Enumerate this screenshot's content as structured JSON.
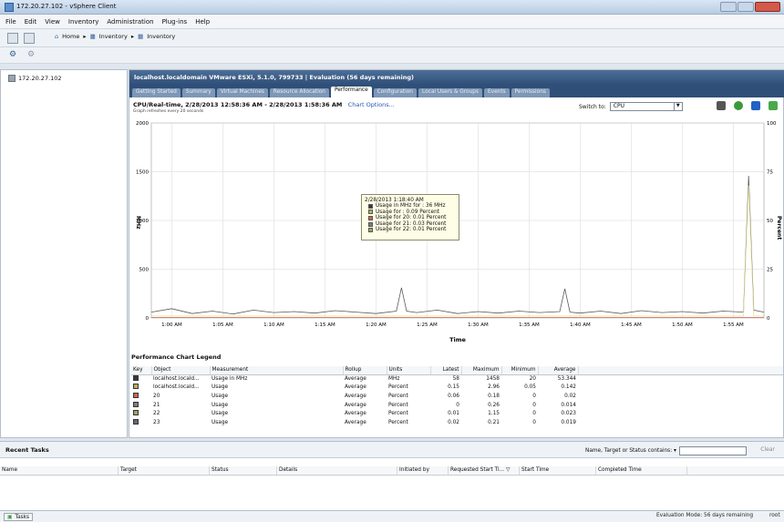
{
  "window": {
    "title": "172.20.27.102 - vSphere Client"
  },
  "menu": [
    "File",
    "Edit",
    "View",
    "Inventory",
    "Administration",
    "Plug-ins",
    "Help"
  ],
  "breadcrumb": {
    "home": "Home",
    "items": [
      "Inventory",
      "Inventory"
    ]
  },
  "tree": {
    "host": "172.20.27.102"
  },
  "host_header": "localhost.localdomain VMware ESXi, 5.1.0, 799733 | Evaluation (56 days remaining)",
  "tabs": [
    "Getting Started",
    "Summary",
    "Virtual Machines",
    "Resource Allocation",
    "Performance",
    "Configuration",
    "Local Users & Groups",
    "Events",
    "Permissions"
  ],
  "active_tab": "Performance",
  "chart_header": {
    "title": "CPU/Real-time, 2/28/2013 12:58:36 AM - 2/28/2013 1:58:36 AM",
    "options_link": "Chart Options...",
    "refresh_note": "Graph refreshes every 20 seconds"
  },
  "switch_to": {
    "label": "Switch to:",
    "value": "CPU"
  },
  "colors": {
    "header_blue": "#2f4f78",
    "link": "#2457b5"
  },
  "chart_data": {
    "type": "line",
    "xlabel": "Time",
    "ylabel_left": "MHz",
    "ylabel_right": "Percent",
    "y_left_ticks": [
      "2000",
      "1500",
      "1000",
      "500",
      "0"
    ],
    "y_right_ticks": [
      "100",
      "75",
      "50",
      "25",
      "0"
    ],
    "ylim_left": [
      0,
      2000
    ],
    "ylim_right": [
      0,
      100
    ],
    "x_ticks": [
      "1:00 AM",
      "1:05 AM",
      "1:10 AM",
      "1:15 AM",
      "1:20 AM",
      "1:25 AM",
      "1:30 AM",
      "1:35 AM",
      "1:40 AM",
      "1:45 AM",
      "1:50 AM",
      "1:55 AM"
    ],
    "grid": true,
    "series": [
      {
        "name": "localhost.localdomain Usage in MHz",
        "axis": "left",
        "color": "#5a5a5a",
        "x_minutes": [
          0,
          2,
          4,
          6,
          8,
          10,
          12,
          14,
          16,
          18,
          20,
          22,
          24,
          24.5,
          25,
          26,
          28,
          30,
          32,
          34,
          36,
          38,
          40,
          40.5,
          41,
          42,
          44,
          46,
          48,
          50,
          52,
          54,
          56,
          58,
          58.5,
          59,
          60
        ],
        "values": [
          60,
          95,
          45,
          70,
          40,
          80,
          55,
          65,
          50,
          75,
          60,
          45,
          70,
          310,
          70,
          55,
          80,
          45,
          65,
          50,
          70,
          55,
          65,
          300,
          60,
          50,
          70,
          45,
          75,
          55,
          65,
          50,
          70,
          60,
          1458,
          80,
          60
        ]
      },
      {
        "name": "localhost.localdomain Usage",
        "axis": "right",
        "color": "#e8e2a0",
        "x_minutes": [
          0,
          10,
          20,
          30,
          40,
          50,
          58,
          58.5,
          59,
          60
        ],
        "values": [
          1,
          1,
          1,
          1,
          1,
          1,
          1,
          68,
          1,
          1
        ]
      }
    ]
  },
  "tooltip": {
    "time": "2/28/2013 1:18:40 AM",
    "lines": [
      {
        "text": "Usage in MHz for : 36 MHz",
        "color": "#3a3a3a"
      },
      {
        "text": "Usage for : 0.09 Percent",
        "color": "#b9b060"
      },
      {
        "text": "Usage for 20: 0.01 Percent",
        "color": "#cc6655"
      },
      {
        "text": "Usage for 21: 0.03 Percent",
        "color": "#7d7d7d"
      },
      {
        "text": "Usage for 22: 0.01 Percent",
        "color": "#9aa860"
      }
    ]
  },
  "legend": {
    "title": "Performance Chart Legend",
    "columns": [
      "Key",
      "Object",
      "Measurement",
      "Rollup",
      "Units",
      "Latest",
      "Maximum",
      "Minimum",
      "Average"
    ],
    "rows": [
      {
        "color": "#3a3a3a",
        "object": "localhost.locald...",
        "measurement": "Usage in MHz",
        "rollup": "Average",
        "units": "MHz",
        "latest": "58",
        "maximum": "1458",
        "minimum": "20",
        "average": "53.344"
      },
      {
        "color": "#b9b060",
        "object": "localhost.locald...",
        "measurement": "Usage",
        "rollup": "Average",
        "units": "Percent",
        "latest": "0.15",
        "maximum": "2.96",
        "minimum": "0.05",
        "average": "0.142"
      },
      {
        "color": "#cc6655",
        "object": "20",
        "measurement": "Usage",
        "rollup": "Average",
        "units": "Percent",
        "latest": "0.06",
        "maximum": "0.18",
        "minimum": "0",
        "average": "0.02"
      },
      {
        "color": "#7d7d7d",
        "object": "21",
        "measurement": "Usage",
        "rollup": "Average",
        "units": "Percent",
        "latest": "0",
        "maximum": "0.26",
        "minimum": "0",
        "average": "0.014"
      },
      {
        "color": "#9aa860",
        "object": "22",
        "measurement": "Usage",
        "rollup": "Average",
        "units": "Percent",
        "latest": "0.01",
        "maximum": "1.15",
        "minimum": "0",
        "average": "0.023"
      },
      {
        "color": "#5e6a7a",
        "object": "23",
        "measurement": "Usage",
        "rollup": "Average",
        "units": "Percent",
        "latest": "0.02",
        "maximum": "0.21",
        "minimum": "0",
        "average": "0.019"
      }
    ]
  },
  "recent_tasks": {
    "title": "Recent Tasks",
    "filter_label": "Name, Target or Status contains: ▾",
    "clear": "Clear",
    "columns": [
      "Name",
      "Target",
      "Status",
      "Details",
      "Initiated by",
      "Requested Start Ti... ▽",
      "Start Time",
      "Completed Time"
    ]
  },
  "statusbar": {
    "tasks": "Tasks",
    "evaluation": "Evaluation Mode: 56 days remaining",
    "user": "root"
  }
}
